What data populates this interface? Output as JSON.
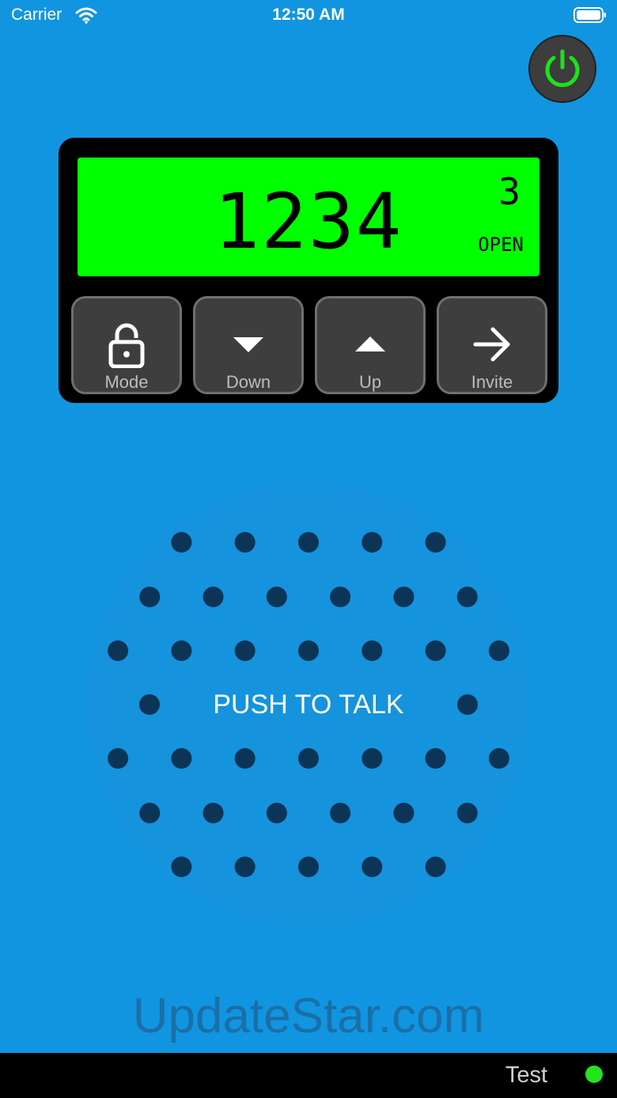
{
  "status_bar": {
    "carrier": "Carrier",
    "time": "12:50 AM"
  },
  "display": {
    "number": "1234",
    "channel": "3",
    "status": "OPEN"
  },
  "buttons": [
    {
      "label": "Mode",
      "icon": "lock-open-icon"
    },
    {
      "label": "Down",
      "icon": "triangle-down-icon"
    },
    {
      "label": "Up",
      "icon": "triangle-up-icon"
    },
    {
      "label": "Invite",
      "icon": "arrow-right-icon"
    }
  ],
  "ptt": {
    "label": "PUSH TO TALK"
  },
  "watermark": "UpdateStar.com",
  "bottom_bar": {
    "text": "Test",
    "indicator_color": "#22e51e"
  },
  "colors": {
    "background": "#1195e0",
    "lcd": "#00ff00",
    "power_icon": "#1ee01e"
  }
}
